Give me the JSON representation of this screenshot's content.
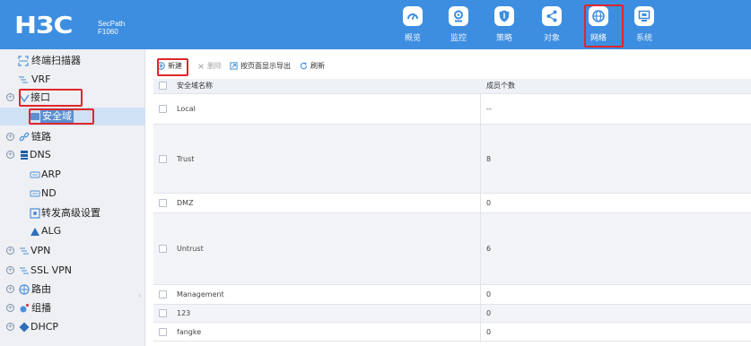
{
  "brand": {
    "logo": "H3C",
    "product_line1": "SecPath",
    "product_line2": "F1060"
  },
  "nav": [
    {
      "label": "概览",
      "icon": "gauge-icon"
    },
    {
      "label": "监控",
      "icon": "monitor-pin-icon"
    },
    {
      "label": "策略",
      "icon": "shield-icon"
    },
    {
      "label": "对象",
      "icon": "share-nodes-icon"
    },
    {
      "label": "网络",
      "icon": "globe-icon",
      "active": true
    },
    {
      "label": "系统",
      "icon": "display-icon"
    }
  ],
  "sidebar": {
    "items": [
      {
        "label": "终端扫描器",
        "icon": "scanner-icon"
      },
      {
        "label": "VRF",
        "icon": "vrf-icon"
      },
      {
        "label": "接口",
        "icon": "interface-icon",
        "expandable": true
      },
      {
        "label": "安全域",
        "icon": "security-zone-icon",
        "selected": true
      },
      {
        "label": "链路",
        "icon": "link-icon",
        "expandable": true
      },
      {
        "label": "DNS",
        "icon": "dns-icon",
        "expandable": true
      },
      {
        "label": "ARP",
        "icon": "arp-icon"
      },
      {
        "label": "ND",
        "icon": "nd-icon"
      },
      {
        "label": "转发高级设置",
        "icon": "forward-settings-icon"
      },
      {
        "label": "ALG",
        "icon": "alg-icon"
      },
      {
        "label": "VPN",
        "icon": "vpn-icon",
        "expandable": true
      },
      {
        "label": "SSL VPN",
        "icon": "ssl-vpn-icon",
        "expandable": true
      },
      {
        "label": "路由",
        "icon": "route-icon",
        "expandable": true
      },
      {
        "label": "组播",
        "icon": "multicast-icon",
        "expandable": true
      },
      {
        "label": "DHCP",
        "icon": "dhcp-icon",
        "expandable": true
      }
    ]
  },
  "toolbar": {
    "new_label": "新建",
    "delete_label": "删除",
    "export_label": "按页面显示导出",
    "refresh_label": "刷新"
  },
  "table": {
    "columns": [
      "安全域名称",
      "成员个数"
    ],
    "rows": [
      {
        "name": "Local",
        "count": "--"
      },
      {
        "name": "Trust",
        "count": "8"
      },
      {
        "name": "DMZ",
        "count": "0"
      },
      {
        "name": "Untrust",
        "count": "6"
      },
      {
        "name": "Management",
        "count": "0"
      },
      {
        "name": "123",
        "count": "0"
      },
      {
        "name": "fangke",
        "count": "0"
      }
    ]
  },
  "colors": {
    "header": "#3d8ee0",
    "highlight": "#e0262b",
    "sidebar_bg": "#eef0f4",
    "selected_bg": "#cfe1f5"
  }
}
